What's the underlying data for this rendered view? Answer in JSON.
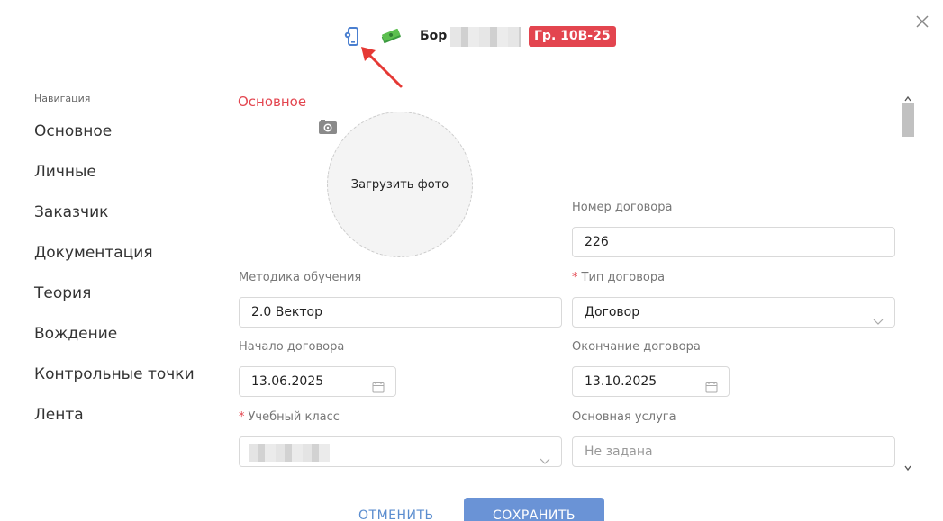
{
  "header": {
    "student_name": "Бор",
    "group_badge": "Гр. 10В-25",
    "icons": [
      "phone-settings-icon",
      "money-icon",
      "close-icon"
    ],
    "badge_color": "#e3454f"
  },
  "nav": {
    "heading": "Навигация",
    "items": [
      {
        "label": "Основное"
      },
      {
        "label": "Личные"
      },
      {
        "label": "Заказчик"
      },
      {
        "label": "Документация"
      },
      {
        "label": "Теория"
      },
      {
        "label": "Вождение"
      },
      {
        "label": "Контрольные точки"
      },
      {
        "label": "Лента"
      }
    ]
  },
  "form": {
    "section_title": "Основное",
    "photo_upload_label": "Загрузить фото",
    "contract_number": {
      "label": "Номер договора",
      "value": "226"
    },
    "teaching_method": {
      "label": "Методика обучения",
      "value": "2.0 Вектор"
    },
    "contract_type": {
      "label": "Тип договора",
      "value": "Договор",
      "required": true
    },
    "contract_start": {
      "label": "Начало договора",
      "value": "13.06.2025"
    },
    "contract_end": {
      "label": "Окончание договора",
      "value": "13.10.2025"
    },
    "classroom": {
      "label": "Учебный класс",
      "value": "",
      "required": true
    },
    "main_service": {
      "label": "Основная услуга",
      "placeholder": "Не задана"
    }
  },
  "footer": {
    "cancel_label": "ОТМЕНИТЬ",
    "save_label": "СОХРАНИТЬ"
  },
  "colors": {
    "accent_red": "#e3454f",
    "primary_blue": "#6a93d6",
    "link_blue": "#5b8dcf"
  }
}
